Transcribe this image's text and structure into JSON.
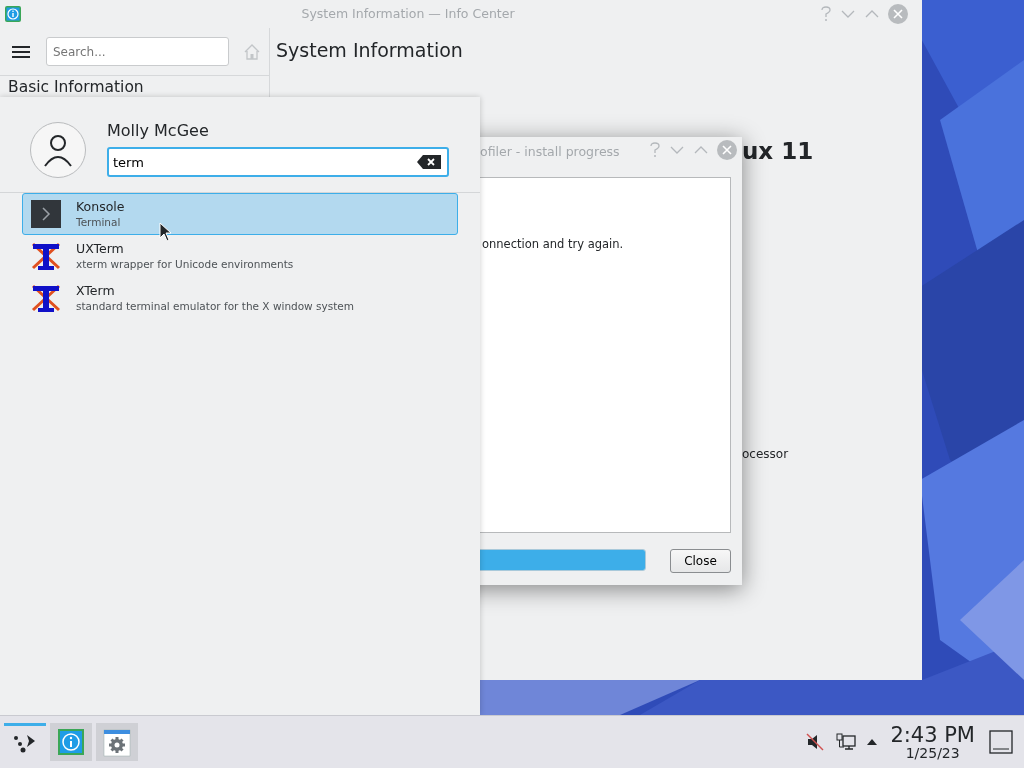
{
  "info_center": {
    "title": "System Information — Info Center",
    "search": {
      "placeholder": "Search..."
    },
    "page_title": "System Information",
    "sidebar_heading": "Basic Information",
    "fragments": [
      {
        "kind": "heading",
        "text": "ux 11"
      },
      {
        "kind": "label",
        "text": "ocessor"
      }
    ]
  },
  "dialog": {
    "title": "ofiler - install progress",
    "message": "onnection and try again.",
    "progress": {
      "level": 1
    },
    "close_button": "Close"
  },
  "launcher": {
    "user": "Molly McGee",
    "search": {
      "value": "term"
    },
    "results": [
      {
        "kind": "konsole",
        "name": "Konsole",
        "description": "Terminal",
        "selected": true
      },
      {
        "kind": "xterm",
        "name": "UXTerm",
        "description": "xterm wrapper for Unicode environments",
        "selected": false
      },
      {
        "kind": "xterm",
        "name": "XTerm",
        "description": "standard terminal emulator for the X window system",
        "selected": false
      }
    ]
  },
  "taskbar": {
    "tasks": [
      {
        "kind": "launcher",
        "active": true
      },
      {
        "kind": "info",
        "active": false
      },
      {
        "kind": "settings",
        "active": false
      }
    ],
    "time": "2:43 PM",
    "date": "1/25/23"
  }
}
